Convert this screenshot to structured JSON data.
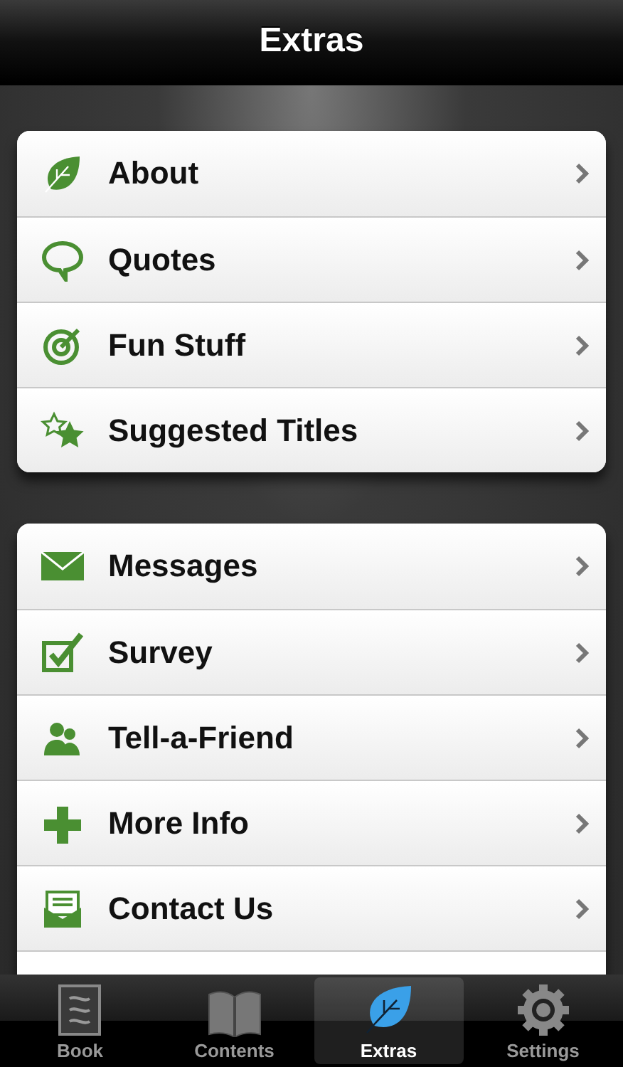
{
  "nav_bar": {
    "title": "Extras"
  },
  "groups": [
    {
      "items": [
        {
          "label": "About"
        },
        {
          "label": "Quotes"
        },
        {
          "label": "Fun Stuff"
        },
        {
          "label": "Suggested Titles"
        }
      ]
    },
    {
      "items": [
        {
          "label": "Messages"
        },
        {
          "label": "Survey"
        },
        {
          "label": "Tell-a-Friend"
        },
        {
          "label": "More Info"
        },
        {
          "label": "Contact Us"
        }
      ]
    }
  ],
  "tab_bar": {
    "tabs": [
      {
        "label": "Book",
        "selected": false
      },
      {
        "label": "Contents",
        "selected": false
      },
      {
        "label": "Extras",
        "selected": true
      },
      {
        "label": "Settings",
        "selected": false
      }
    ]
  }
}
